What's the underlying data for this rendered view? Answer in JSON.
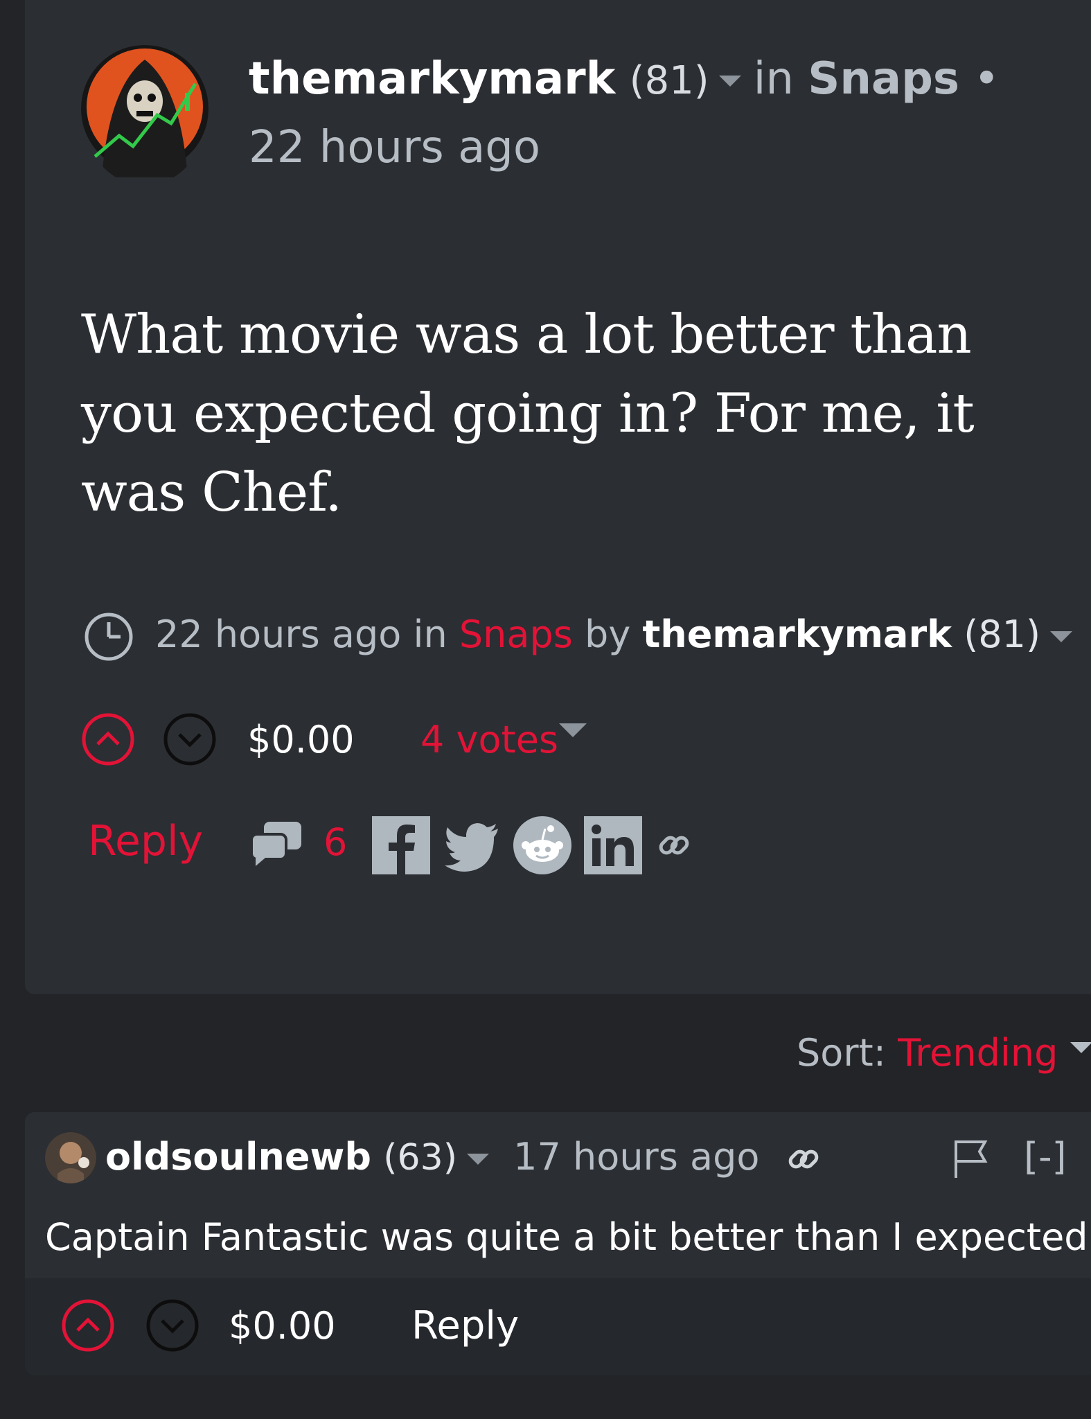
{
  "post": {
    "author": "themarkymark",
    "author_rep": "(81)",
    "in_word": "in",
    "category": "Snaps",
    "bullet": "•",
    "time_header": "22 hours ago",
    "title": "What movie was a lot better than you expected going in? For me, it was Chef.",
    "meta": {
      "time": "22 hours ago",
      "in_word": "in",
      "category": "Snaps",
      "by_word": "by",
      "author": "themarkymark",
      "author_rep": "(81)"
    },
    "payout": "$0.00",
    "votes": "4 votes",
    "reply_label": "Reply",
    "comment_count": "6",
    "share_icons": [
      "facebook-icon",
      "twitter-icon",
      "reddit-icon",
      "linkedin-icon",
      "permalink-icon"
    ]
  },
  "sort": {
    "label": "Sort:",
    "value": "Trending"
  },
  "comment": {
    "author": "oldsoulnewb",
    "author_rep": "(63)",
    "time": "17 hours ago",
    "collapse": "[-]",
    "body": "Captain Fantastic was quite a bit better than I expected it to be",
    "payout": "$0.00",
    "reply_label": "Reply"
  },
  "colors": {
    "accent": "#e31337",
    "background": "#222427",
    "card": "#2b2e33",
    "muted_text": "#b7bdc4",
    "icon_gray": "#b0b8bf"
  }
}
